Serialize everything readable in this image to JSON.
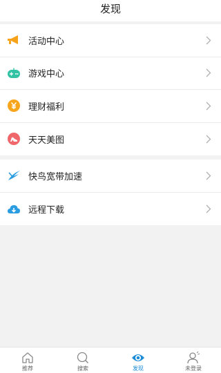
{
  "header": {
    "title": "发现"
  },
  "menu_group_1": [
    {
      "label": "活动中心",
      "icon": "megaphone-icon",
      "color": "#f6a21a"
    },
    {
      "label": "游戏中心",
      "icon": "gamepad-icon",
      "color": "#33c3a4"
    },
    {
      "label": "理财福利",
      "icon": "yuan-coin-icon",
      "color": "#f7a51c"
    },
    {
      "label": "天天美图",
      "icon": "high-heel-icon",
      "color": "#f0676b"
    }
  ],
  "menu_group_2": [
    {
      "label": "快鸟宽带加速",
      "icon": "swift-bird-icon",
      "color": "#2a9ce0"
    },
    {
      "label": "远程下载",
      "icon": "cloud-download-icon",
      "color": "#2a9ce0"
    }
  ],
  "bottom_nav": [
    {
      "label": "推荐",
      "icon": "home-icon",
      "active": false
    },
    {
      "label": "搜索",
      "icon": "search-icon",
      "active": false
    },
    {
      "label": "发现",
      "icon": "eye-icon",
      "active": true
    },
    {
      "label": "未登录",
      "icon": "user-icon",
      "active": false
    }
  ],
  "colors": {
    "accent": "#1a8cd8",
    "background": "#f2f2f2"
  }
}
